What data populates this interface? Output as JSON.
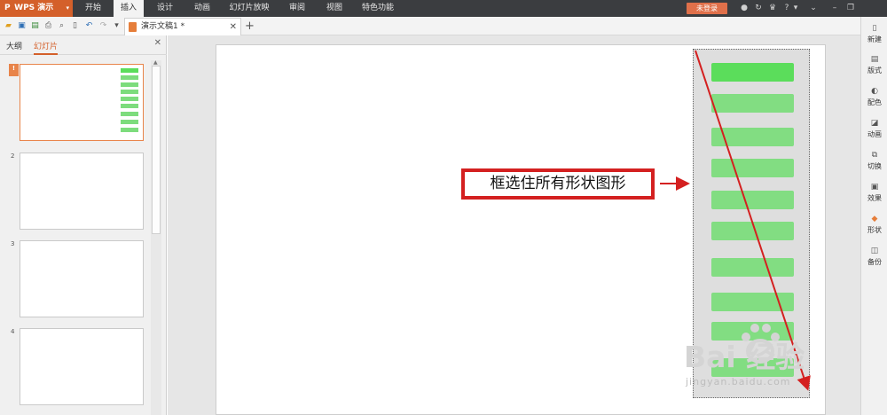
{
  "titlebar": {
    "app_name": "WPS 演示",
    "menu": [
      "开始",
      "插入",
      "设计",
      "动画",
      "幻灯片放映",
      "审阅",
      "视图",
      "特色功能"
    ],
    "active_menu": "插入",
    "login": "未登录"
  },
  "tabs": {
    "document": "演示文稿1 *",
    "add": "+"
  },
  "left_panel": {
    "tabs": [
      "大纲",
      "幻灯片"
    ],
    "active_tab": "幻灯片",
    "slide_numbers": [
      "1",
      "2",
      "3",
      "4"
    ],
    "selected_marker": "!"
  },
  "slide": {
    "callout_text": "框选住所有形状图形",
    "green_bar_count": 10
  },
  "watermark": {
    "brand": "Bai  经验",
    "url": "jingyan.baidu.com"
  },
  "right_bar": {
    "items": [
      "新建",
      "版式",
      "配色",
      "动画",
      "切换",
      "效果",
      "形状",
      "备份"
    ]
  },
  "colors": {
    "accent": "#d4602a",
    "callout_border": "#d42020",
    "shape_fill": "#82dd82",
    "arrow": "#d42020"
  }
}
